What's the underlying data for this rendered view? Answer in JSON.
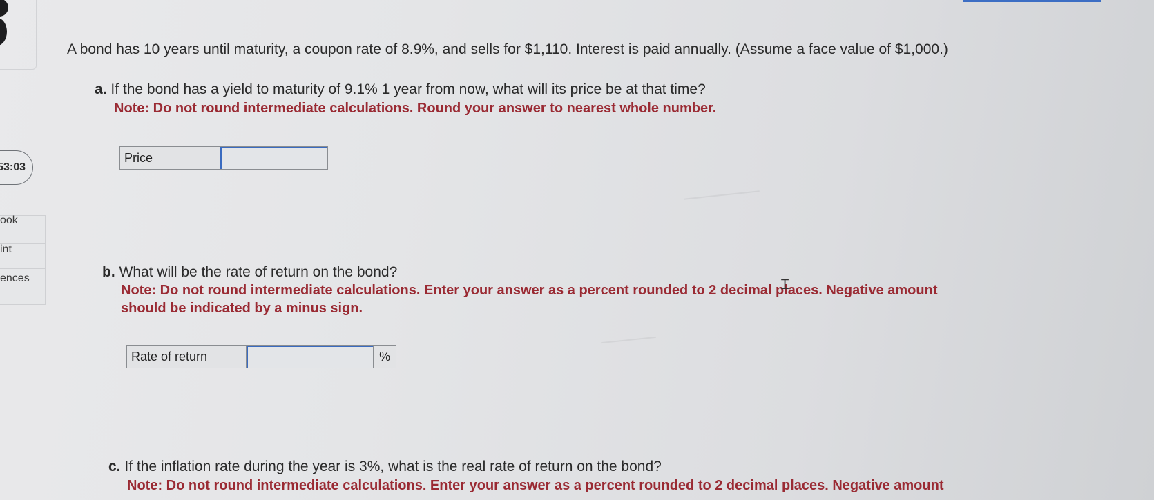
{
  "sidebar": {
    "timer": ":53:03",
    "items": [
      {
        "label": "ook"
      },
      {
        "label": "int"
      },
      {
        "label": "ences"
      }
    ]
  },
  "problem": {
    "intro": "A bond has 10 years until maturity, a coupon rate of 8.9%, and sells for $1,110. Interest is paid annually. (Assume a face value of $1,000.)",
    "part_a": {
      "letter": "a.",
      "question": "If the bond has a yield to maturity of 9.1% 1 year from now, what will its price be at that time?",
      "note": "Note: Do not round intermediate calculations. Round your answer to nearest whole number.",
      "answer_label": "Price",
      "answer_value": ""
    },
    "part_b": {
      "letter": "b.",
      "question": "What will be the rate of return on the bond?",
      "note_line1": "Note: Do not round intermediate calculations. Enter your answer as a percent rounded to 2 decimal places. Negative amount",
      "note_line2": "should be indicated by a minus sign.",
      "answer_label": "Rate of return",
      "answer_value": "",
      "unit": "%"
    },
    "part_c": {
      "letter": "c.",
      "question": "If the inflation rate during the year is 3%, what is the real rate of return on the bond?",
      "note_line1": "Note: Do not round intermediate calculations. Enter your answer as a percent rounded to 2 decimal places. Negative amount"
    }
  },
  "colors": {
    "note_red": "#9a2a33",
    "input_focus_blue": "#3a6bc0"
  }
}
